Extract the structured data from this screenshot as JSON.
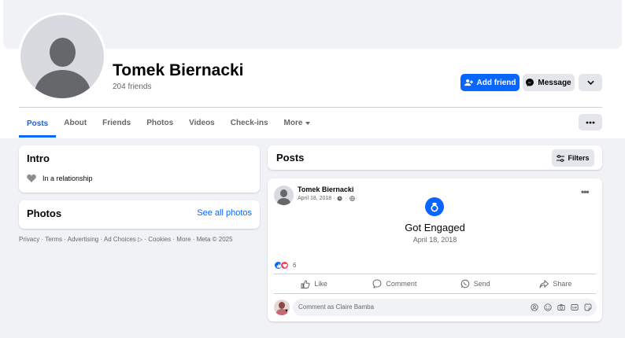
{
  "profile": {
    "name": "Tomek Biernacki",
    "friends_count": "204 friends",
    "add_friend_label": "Add friend",
    "message_label": "Message"
  },
  "tabs": [
    {
      "label": "Posts",
      "active": true
    },
    {
      "label": "About"
    },
    {
      "label": "Friends"
    },
    {
      "label": "Photos"
    },
    {
      "label": "Videos"
    },
    {
      "label": "Check-ins"
    },
    {
      "label": "More"
    }
  ],
  "intro": {
    "title": "Intro",
    "relationship": "In a relationship"
  },
  "photos": {
    "title": "Photos",
    "see_all": "See all photos"
  },
  "footer": {
    "links": "Privacy · Terms · Advertising · Ad Choices ▷ · Cookies · More · Meta © 2025"
  },
  "posts_section": {
    "title": "Posts",
    "filters_label": "Filters"
  },
  "post": {
    "author": "Tomek Biernacki",
    "date": "April 18, 2018 ·",
    "event_title": "Got Engaged",
    "event_date": "April 18, 2018",
    "reaction_count": "6",
    "actions": {
      "like": "Like",
      "comment": "Comment",
      "send": "Send",
      "share": "Share"
    },
    "comment_placeholder": "Comment as Claire Bamba"
  },
  "colors": {
    "primary": "#0866ff",
    "secondary_bg": "#e4e6eb",
    "page_bg": "#f0f2f5",
    "text_muted": "#65676b",
    "love": "#f33e58"
  }
}
